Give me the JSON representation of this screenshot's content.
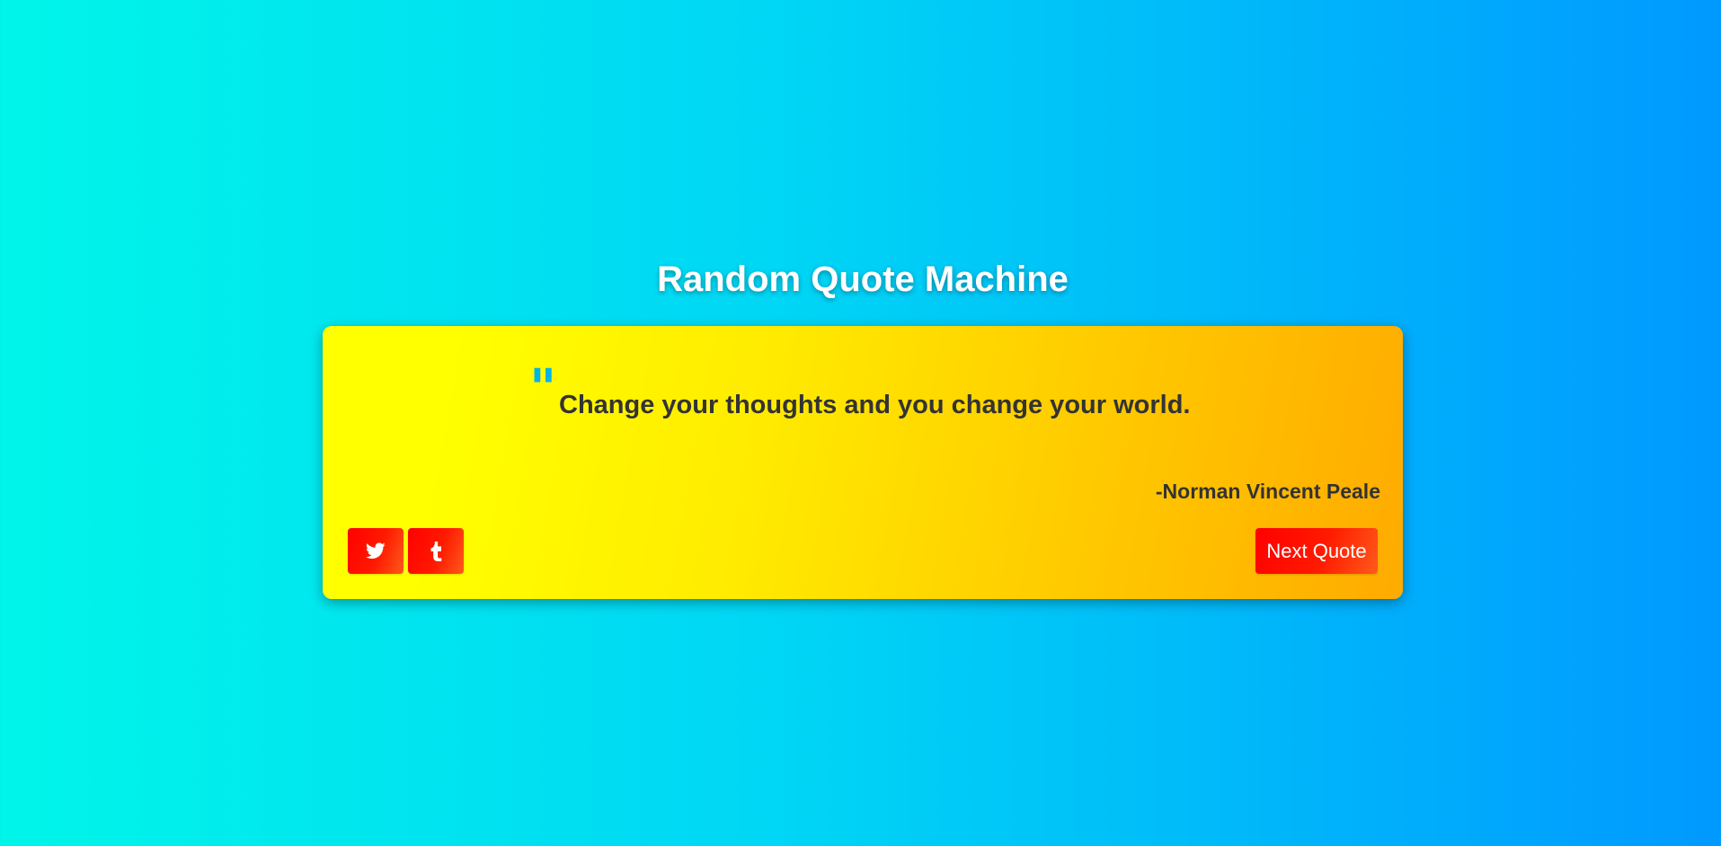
{
  "page": {
    "title": "Random Quote Machine"
  },
  "quote": {
    "open_mark": "\"",
    "text": "Change your thoughts and you change your world.",
    "author": "-Norman Vincent Peale"
  },
  "buttons": {
    "twitter_icon": "twitter-icon",
    "tumblr_icon": "tumblr-icon",
    "next_label": "Next Quote"
  },
  "colors": {
    "background_start": "#00f5e9",
    "background_end": "#0099ff",
    "card_start": "#ffff00",
    "card_end": "#ffab00",
    "button": "#ff0000",
    "quote_mark": "#00b4e8",
    "text": "#333333"
  }
}
